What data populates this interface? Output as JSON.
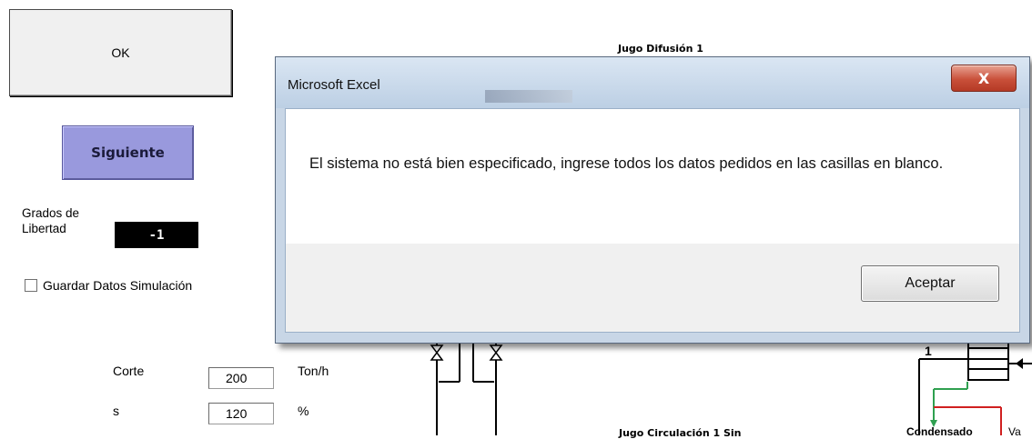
{
  "sheet": {
    "ok_label": "OK",
    "next_label": "Siguiente",
    "degrees_label": "Grados de Libertad",
    "degrees_value": "-1",
    "save_checkbox_label": "Guardar Datos Simulación",
    "params": [
      {
        "label": "Corte",
        "value": "200",
        "unit": "Ton/h"
      },
      {
        "label": "s",
        "value": "120",
        "unit": "%"
      }
    ]
  },
  "diagram": {
    "title_top": "Jugo Difusión 1",
    "label_stage": "1",
    "label_condensado": "Condensado",
    "label_va": "Va",
    "title_bottom": "Jugo Circulación 1 Sin"
  },
  "dialog": {
    "title": "Microsoft Excel",
    "close_glyph": "X",
    "message": "El sistema no está bien especificado, ingrese todos los datos pedidos en las casillas en blanco.",
    "accept_label": "Aceptar"
  },
  "colors": {
    "next_button": "#9999dd",
    "close_button": "#c9503a",
    "dialog_frame": "#c8d6e6",
    "pipe_green": "#2fa050",
    "pipe_red": "#d02020"
  }
}
